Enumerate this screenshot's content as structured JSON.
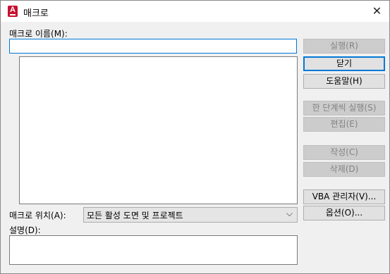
{
  "window": {
    "title": "매크로",
    "close_glyph": "✕",
    "app_icon": "autocad-a-icon",
    "app_icon_letter": "A"
  },
  "macro_name": {
    "label": "매크로 이름(M):",
    "value": ""
  },
  "macro_location": {
    "label": "매크로 위치(A):",
    "selected": "모든 활성 도면 및 프로젝트",
    "chevron": "⌵"
  },
  "description": {
    "label": "설명(D):",
    "value": ""
  },
  "buttons": {
    "run": "실행(R)",
    "close": "닫기",
    "help": "도움말(H)",
    "step_into": "한 단계씩 실행(S)",
    "edit": "편집(E)",
    "create": "작성(C)",
    "delete": "삭제(D)",
    "vba_manager": "VBA 관리자(V)...",
    "options": "옵션(O)..."
  },
  "colors": {
    "accent": "#0078d7",
    "app_icon": "#c8102e"
  }
}
